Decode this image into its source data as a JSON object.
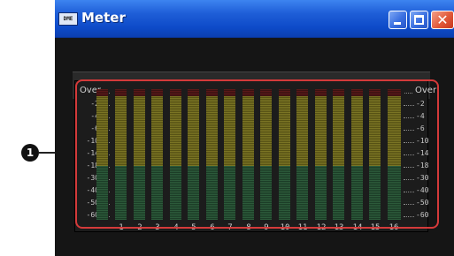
{
  "window": {
    "title": "Meter",
    "app_icon_text": "DME",
    "close_glyph": "✕"
  },
  "scale": {
    "labels": [
      "Over",
      "-2",
      "-4",
      "-6",
      "-10",
      "-14",
      "-18",
      "-30",
      "-40",
      "-50",
      "-60"
    ]
  },
  "channels": [
    "1",
    "2",
    "3",
    "4",
    "5",
    "6",
    "7",
    "8",
    "9",
    "10",
    "11",
    "12",
    "13",
    "14",
    "15",
    "16"
  ],
  "callout": {
    "number": "1"
  },
  "colors": {
    "titlebar": "#1f5fd8",
    "meter_over": "#5a1818",
    "meter_high": "#7a7424",
    "meter_low": "#2c5a3a",
    "callout_border": "#d43a3a"
  }
}
